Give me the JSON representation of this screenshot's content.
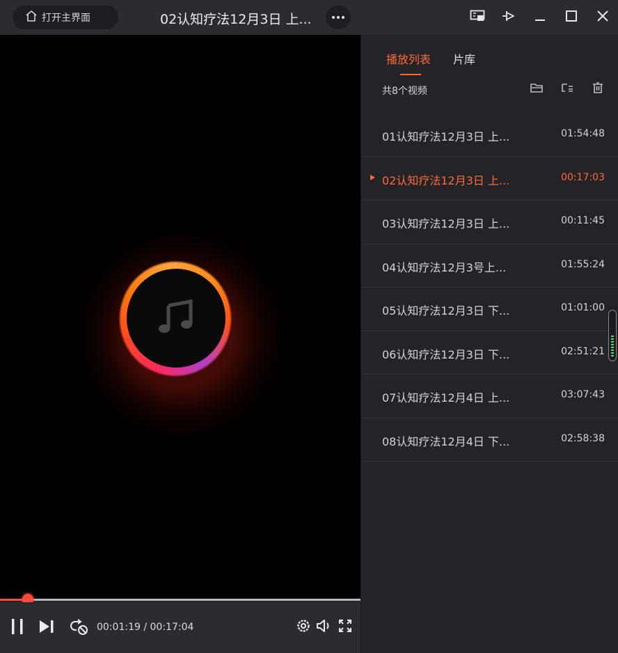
{
  "titlebar": {
    "home_button_label": "打开主界面",
    "title": "02认知疗法12月3日 上..."
  },
  "player": {
    "current_time": "00:01:19",
    "separator": " / ",
    "total_time": "00:17:04",
    "progress_fraction": 0.077
  },
  "sidebar": {
    "tabs": [
      {
        "label": "播放列表",
        "active": true
      },
      {
        "label": "片库",
        "active": false
      }
    ],
    "count_label": "共8个视频",
    "items": [
      {
        "title": "01认知疗法12月3日 上...",
        "duration": "01:54:48",
        "current": false
      },
      {
        "title": "02认知疗法12月3日 上...",
        "duration": "00:17:03",
        "current": true
      },
      {
        "title": "03认知疗法12月3日 上...",
        "duration": "00:11:45",
        "current": false
      },
      {
        "title": "04认知疗法12月3号上...",
        "duration": "01:55:24",
        "current": false
      },
      {
        "title": "05认知疗法12月3日 下...",
        "duration": "01:01:00",
        "current": false
      },
      {
        "title": "06认知疗法12月3日 下...",
        "duration": "02:51:21",
        "current": false
      },
      {
        "title": "07认知疗法12月4日 上...",
        "duration": "03:07:43",
        "current": false
      },
      {
        "title": "08认知疗法12月4日 下...",
        "duration": "02:58:38",
        "current": false
      }
    ]
  },
  "colors": {
    "accent": "#ff6a36",
    "progress": "#ff4b3e",
    "background": "#232328",
    "video_bg": "#000000"
  },
  "icons": {
    "home": "home-icon",
    "more": "more-icon",
    "screen": "screen-icon",
    "pin": "pin-icon",
    "minimize": "minimize-icon",
    "maximize": "maximize-icon",
    "close": "close-icon",
    "music": "music-note-icon",
    "pause": "pause-icon",
    "next": "next-icon",
    "loop": "loop-icon",
    "settings": "gear-icon",
    "volume": "volume-icon",
    "fullscreen": "fullscreen-icon",
    "open_folder": "folder-icon",
    "playlist_mode": "list-icon",
    "delete": "trash-icon"
  }
}
